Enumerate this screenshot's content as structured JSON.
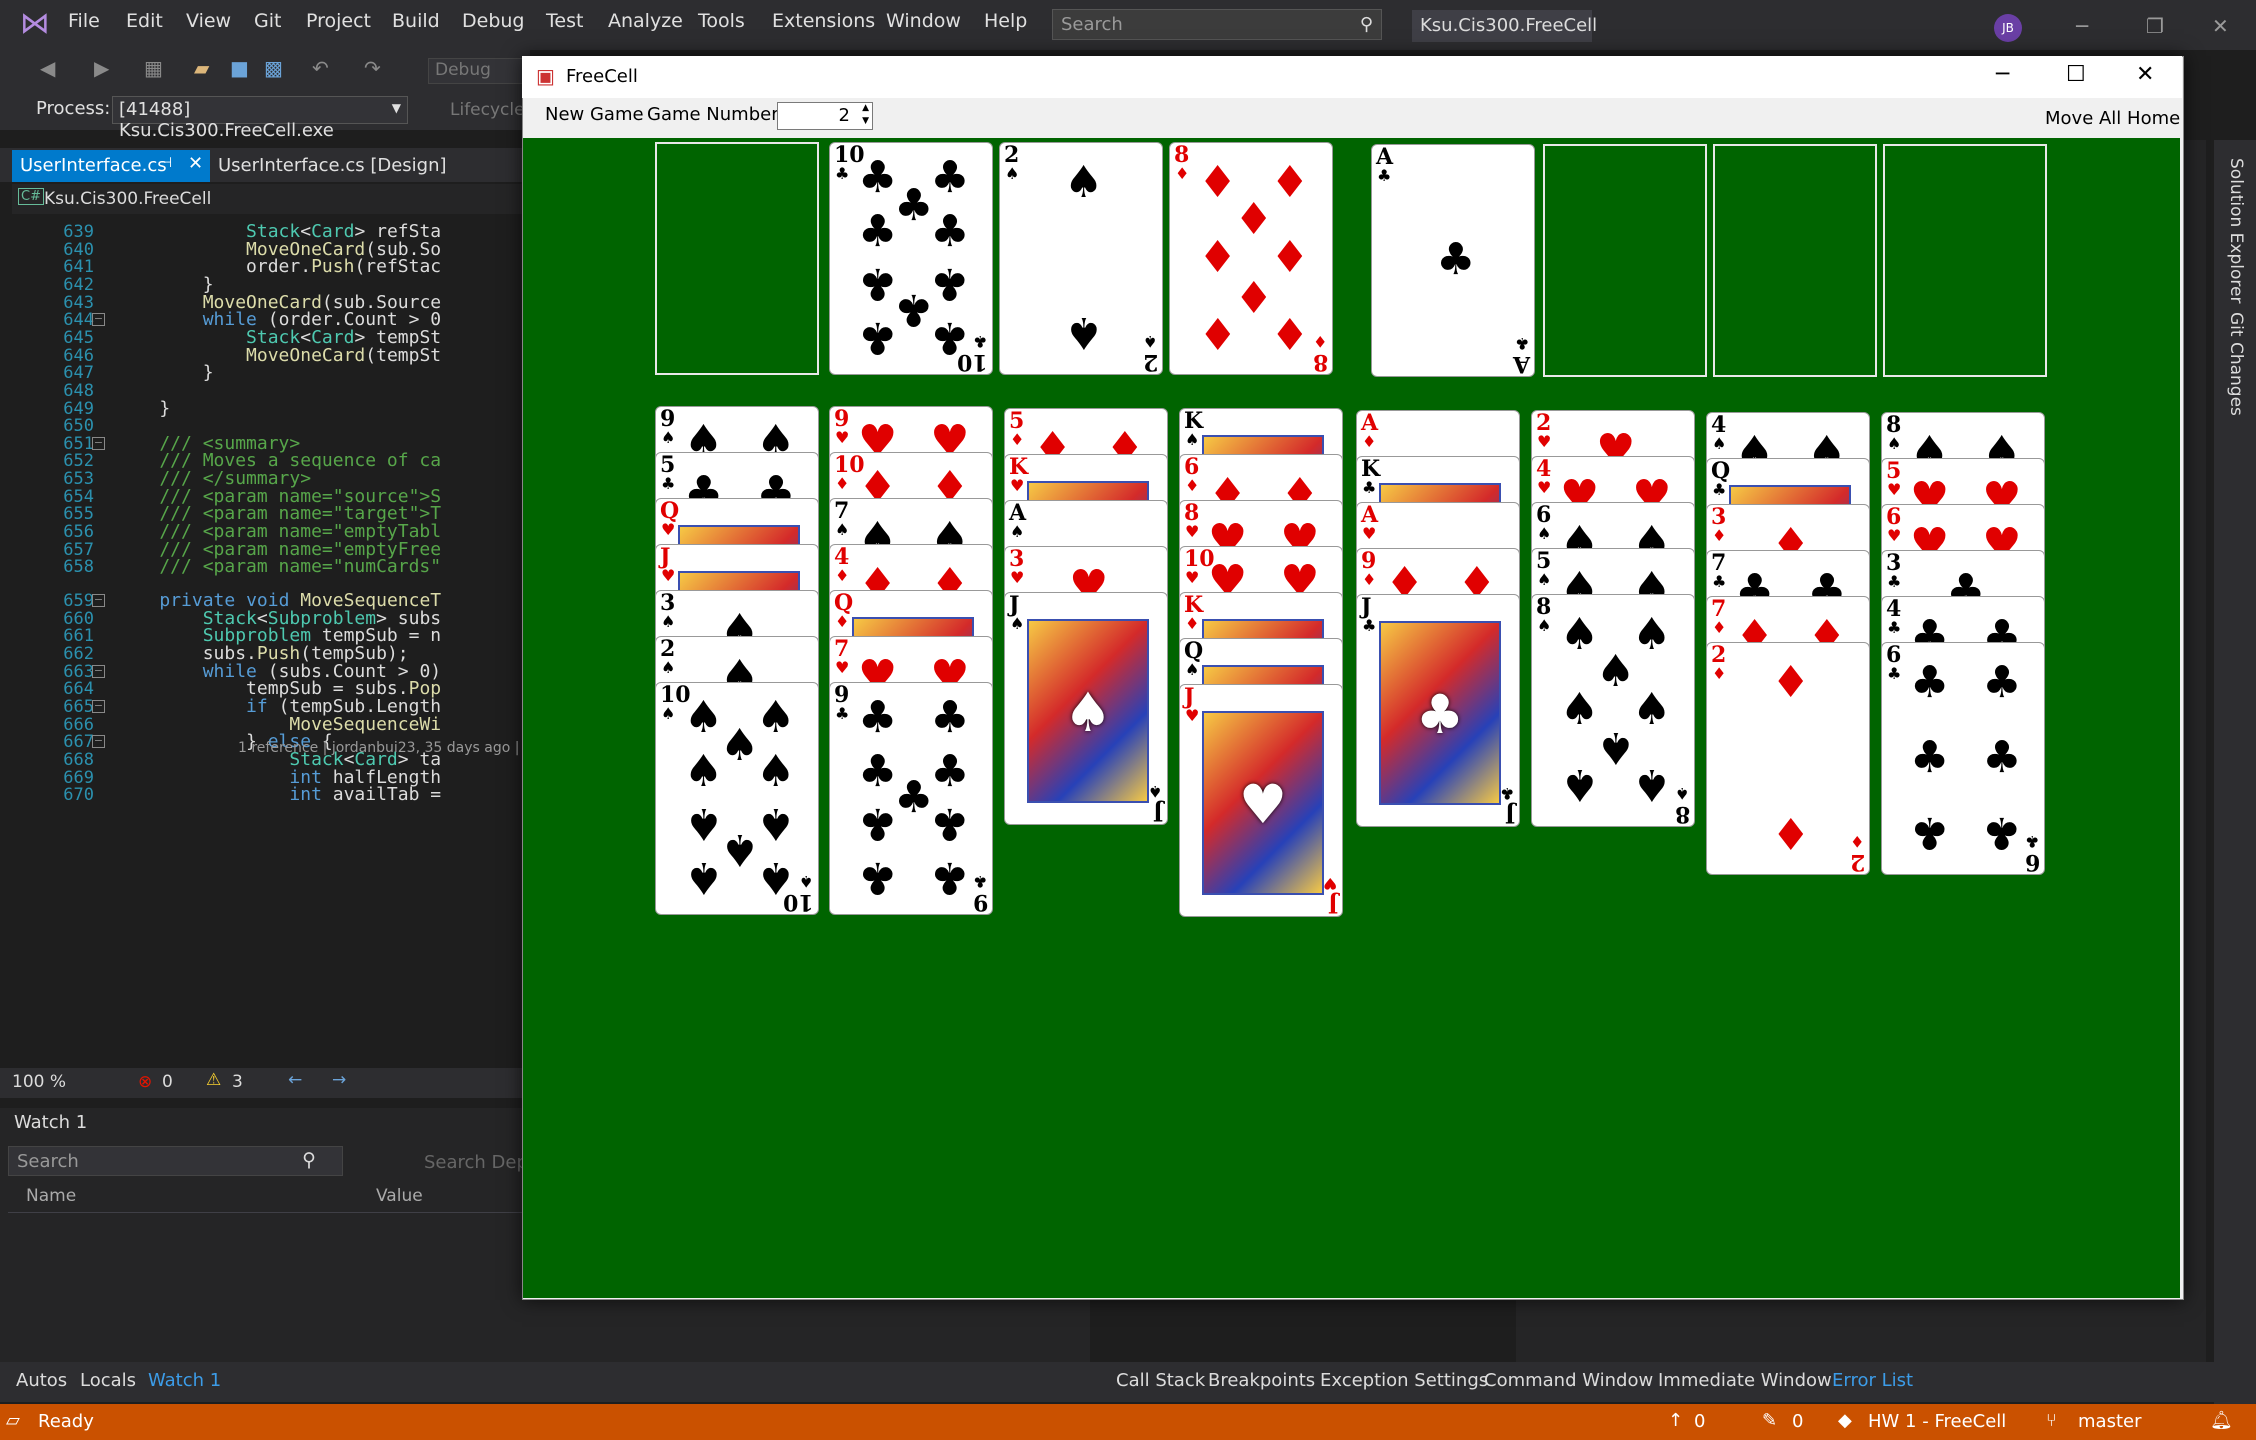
{
  "vs": {
    "menu": [
      "File",
      "Edit",
      "View",
      "Git",
      "Project",
      "Build",
      "Debug",
      "Test",
      "Analyze",
      "Tools",
      "Extensions",
      "Window",
      "Help"
    ],
    "search_placeholder": "Search",
    "solution_title": "Ksu.Cis300.FreeCell",
    "avatar_initials": "JB",
    "config": "Debug",
    "process_label": "Process:",
    "process_value": "[41488] Ksu.Cis300.FreeCell.exe",
    "lifecycle_label": "Lifecycle",
    "tabs": [
      "UserInterface.cs",
      "UserInterface.cs [Design]"
    ],
    "breadcrumb": "Ksu.Cis300.FreeCell",
    "zoom": "100 %",
    "errors": "0",
    "warnings": "3",
    "watch_title": "Watch 1",
    "watch_search": "Search",
    "watch_search_depth": "Search Dept",
    "watch_cols": [
      "Name",
      "Value"
    ],
    "debug_tabs_left": [
      "Autos",
      "Locals",
      "Watch 1"
    ],
    "debug_tabs_right": [
      "Call Stack",
      "Breakpoints",
      "Exception Settings",
      "Command Window",
      "Immediate Window",
      "Error List"
    ],
    "side_tabs": [
      "Solution Explorer",
      "Git Changes"
    ],
    "status": {
      "ready": "Ready",
      "push": "0",
      "pending": "0",
      "repo": "HW 1 - FreeCell",
      "branch": "master"
    }
  },
  "code_lines": [
    {
      "n": "639",
      "code": "            Stack<Card> refSta"
    },
    {
      "n": "640",
      "code": "            MoveOneCard(sub.So"
    },
    {
      "n": "641",
      "code": "            order.Push(refStac"
    },
    {
      "n": "642",
      "code": "        }"
    },
    {
      "n": "643",
      "code": "        MoveOneCard(sub.Source"
    },
    {
      "n": "644",
      "code": "        while (order.Count > 0"
    },
    {
      "n": "645",
      "code": "            Stack<Card> tempSt"
    },
    {
      "n": "646",
      "code": "            MoveOneCard(tempSt"
    },
    {
      "n": "647",
      "code": "        }"
    },
    {
      "n": "648",
      "code": ""
    },
    {
      "n": "649",
      "code": "    }"
    },
    {
      "n": "650",
      "code": ""
    },
    {
      "n": "651",
      "code": "    /// <summary>"
    },
    {
      "n": "652",
      "code": "    /// Moves a sequence of ca"
    },
    {
      "n": "653",
      "code": "    /// </summary>"
    },
    {
      "n": "654",
      "code": "    /// <param name=\"source\">S"
    },
    {
      "n": "655",
      "code": "    /// <param name=\"target\">T"
    },
    {
      "n": "656",
      "code": "    /// <param name=\"emptyTabl"
    },
    {
      "n": "657",
      "code": "    /// <param name=\"emptyFree"
    },
    {
      "n": "658",
      "code": "    /// <param name=\"numCards\""
    },
    {
      "n": "659",
      "code": "    private void MoveSequenceT"
    },
    {
      "n": "660",
      "code": "        Stack<Subproblem> subs"
    },
    {
      "n": "661",
      "code": "        Subproblem tempSub = n"
    },
    {
      "n": "662",
      "code": "        subs.Push(tempSub);"
    },
    {
      "n": "663",
      "code": "        while (subs.Count > 0)"
    },
    {
      "n": "664",
      "code": "            tempSub = subs.Pop"
    },
    {
      "n": "665",
      "code": "            if (tempSub.Length"
    },
    {
      "n": "666",
      "code": "                MoveSequenceWi"
    },
    {
      "n": "667",
      "code": "            } else {"
    },
    {
      "n": "668",
      "code": "                Stack<Card> ta"
    },
    {
      "n": "669",
      "code": "                int halfLength"
    },
    {
      "n": "670",
      "code": "                int availTab ="
    }
  ],
  "codelens": "1 reference | jordanbui23, 35 days ago |",
  "freecell": {
    "title": "FreeCell",
    "new_game": "New Game",
    "game_number_label": "Game Number:",
    "game_number": "2",
    "move_all_home": "Move All Home",
    "free_cells": [
      null,
      {
        "rank": "10",
        "suit": "clubs"
      },
      {
        "rank": "2",
        "suit": "spades"
      },
      {
        "rank": "8",
        "suit": "diamonds"
      }
    ],
    "home_cells": [
      {
        "rank": "A",
        "suit": "clubs"
      },
      null,
      null,
      null
    ],
    "tableau": [
      [
        {
          "rank": "9",
          "suit": "spades"
        },
        {
          "rank": "5",
          "suit": "clubs"
        },
        {
          "rank": "Q",
          "suit": "hearts"
        },
        {
          "rank": "J",
          "suit": "hearts"
        },
        {
          "rank": "3",
          "suit": "spades"
        },
        {
          "rank": "2",
          "suit": "spades"
        },
        {
          "rank": "10",
          "suit": "spades"
        }
      ],
      [
        {
          "rank": "9",
          "suit": "hearts"
        },
        {
          "rank": "10",
          "suit": "diamonds"
        },
        {
          "rank": "7",
          "suit": "spades"
        },
        {
          "rank": "4",
          "suit": "diamonds"
        },
        {
          "rank": "Q",
          "suit": "diamonds"
        },
        {
          "rank": "7",
          "suit": "hearts"
        },
        {
          "rank": "9",
          "suit": "clubs"
        }
      ],
      [
        {
          "rank": "5",
          "suit": "diamonds"
        },
        {
          "rank": "K",
          "suit": "hearts"
        },
        {
          "rank": "A",
          "suit": "spades"
        },
        {
          "rank": "3",
          "suit": "hearts"
        },
        {
          "rank": "J",
          "suit": "spades"
        }
      ],
      [
        {
          "rank": "K",
          "suit": "spades"
        },
        {
          "rank": "6",
          "suit": "diamonds"
        },
        {
          "rank": "8",
          "suit": "hearts"
        },
        {
          "rank": "10",
          "suit": "hearts"
        },
        {
          "rank": "K",
          "suit": "diamonds"
        },
        {
          "rank": "Q",
          "suit": "spades"
        },
        {
          "rank": "J",
          "suit": "hearts"
        }
      ],
      [
        {
          "rank": "A",
          "suit": "diamonds"
        },
        {
          "rank": "K",
          "suit": "clubs"
        },
        {
          "rank": "A",
          "suit": "hearts"
        },
        {
          "rank": "9",
          "suit": "diamonds"
        },
        {
          "rank": "J",
          "suit": "clubs"
        }
      ],
      [
        {
          "rank": "2",
          "suit": "hearts"
        },
        {
          "rank": "4",
          "suit": "hearts"
        },
        {
          "rank": "6",
          "suit": "spades"
        },
        {
          "rank": "5",
          "suit": "spades"
        },
        {
          "rank": "8",
          "suit": "spades"
        }
      ],
      [
        {
          "rank": "4",
          "suit": "spades"
        },
        {
          "rank": "Q",
          "suit": "clubs"
        },
        {
          "rank": "3",
          "suit": "diamonds"
        },
        {
          "rank": "7",
          "suit": "clubs"
        },
        {
          "rank": "7",
          "suit": "diamonds"
        },
        {
          "rank": "2",
          "suit": "diamonds"
        }
      ],
      [
        {
          "rank": "8",
          "suit": "spades"
        },
        {
          "rank": "5",
          "suit": "hearts"
        },
        {
          "rank": "6",
          "suit": "hearts"
        },
        {
          "rank": "3",
          "suit": "clubs"
        },
        {
          "rank": "4",
          "suit": "clubs"
        },
        {
          "rank": "6",
          "suit": "clubs"
        }
      ]
    ]
  },
  "colors": {
    "table_green": "#006400",
    "vs_accent": "#007acc",
    "status_orange": "#ca5100"
  }
}
